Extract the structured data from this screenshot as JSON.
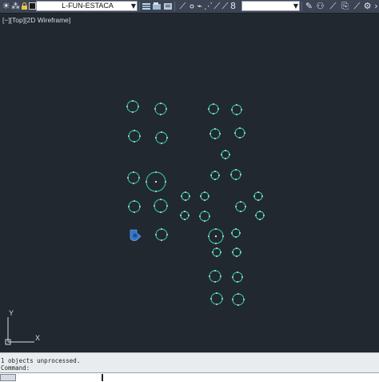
{
  "toolbar": {
    "layer_name": "L-FUN-ESTACA",
    "icons": [
      "sun-icon",
      "layer-freeze-icon",
      "lock-icon",
      "color-swatch-icon"
    ],
    "tools": [
      "layer-properties-icon",
      "layer-state-icon",
      "layer-previous-icon",
      "layer-walk-icon",
      "match-layer-icon",
      "isolate-layer-icon",
      "unisolate-layer-icon",
      "layer-freeze-tool-icon",
      "layer-off-icon",
      "layer-lock-tool-icon",
      "layer-unlock-icon",
      "layer-8-icon"
    ],
    "combo2_value": "",
    "right_icons": [
      "annotation-scale-icon",
      "visibility-icon",
      "sync-icon",
      "add-scale-icon"
    ]
  },
  "viewport": {
    "label": "[−][Top][2D Wireframe]",
    "background": "#212830",
    "entity_color": "#31d6a6"
  },
  "ucs": {
    "x_label": "X",
    "y_label": "Y"
  },
  "command": {
    "history": [
      "1 objects unprocessed.",
      "Command:"
    ],
    "prompt": ""
  }
}
